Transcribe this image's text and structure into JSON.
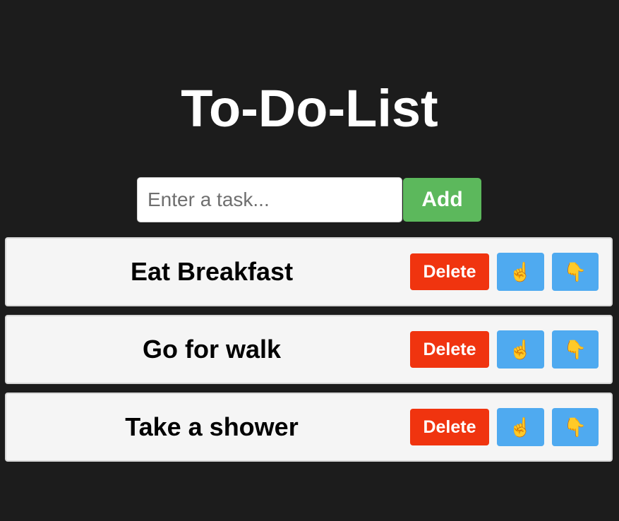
{
  "app": {
    "title": "To-Do-List"
  },
  "input": {
    "placeholder": "Enter a task...",
    "value": ""
  },
  "add_button": {
    "label": "Add"
  },
  "colors": {
    "background": "#1c1c1c",
    "add": "#5cb85c",
    "delete": "#f0340f",
    "move": "#4faaf0",
    "item_background": "#f5f5f5"
  },
  "icons": {
    "move_up": "pointing-up-hand-icon",
    "move_down": "pointing-down-hand-icon"
  },
  "tasks": [
    {
      "text": "Eat Breakfast",
      "delete_label": "Delete",
      "up_glyph": "☝️",
      "down_glyph": "👇"
    },
    {
      "text": "Go for walk",
      "delete_label": "Delete",
      "up_glyph": "☝️",
      "down_glyph": "👇"
    },
    {
      "text": "Take a shower",
      "delete_label": "Delete",
      "up_glyph": "☝️",
      "down_glyph": "👇"
    }
  ]
}
